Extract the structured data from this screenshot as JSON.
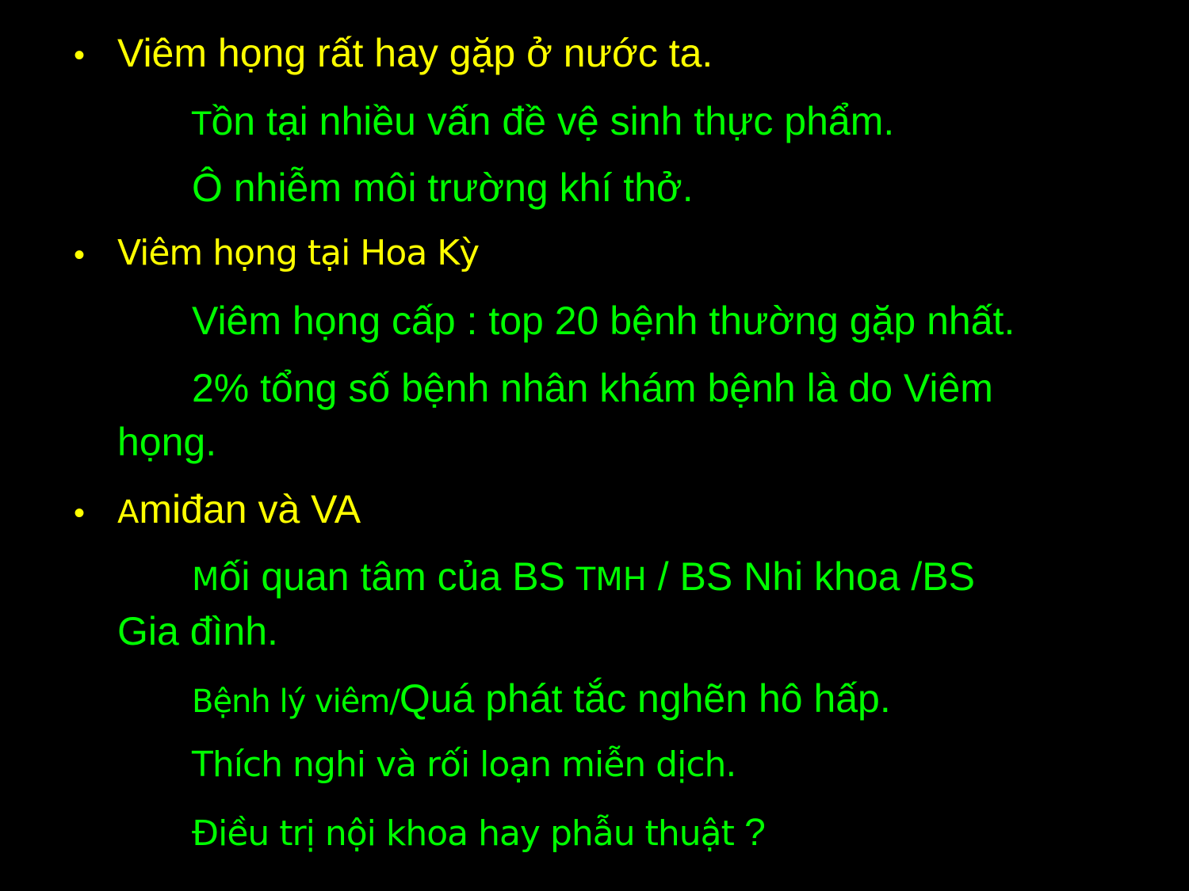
{
  "colors": {
    "background": "#000000",
    "heading": "#ffff00",
    "body": "#00ff00"
  },
  "bullet_glyph": "•",
  "sections": [
    {
      "heading": "Viêm họng rất hay gặp ở nước ta.",
      "items": [
        {
          "prefix": "T",
          "text": "ồn tại nhiều vấn đề vệ sinh thực phẩm."
        },
        {
          "text": "Ô nhiễm môi trường khí thở."
        }
      ]
    },
    {
      "heading": "Viêm họng tại Hoa Kỳ",
      "items": [
        {
          "text": "Viêm họng cấp : top 20 bệnh thường gặp nhất."
        },
        {
          "text": "2% tổng số bệnh nhân khám bệnh là do Viêm",
          "continuation": "họng."
        }
      ]
    },
    {
      "heading_prefix": "A",
      "heading": "miđan và VA",
      "items": [
        {
          "prefix": "M",
          "text_a": "ối quan tâm của BS ",
          "text_small": "TMH",
          "text_b": " / BS Nhi khoa /BS",
          "continuation": "Gia đình."
        },
        {
          "text_small": "Bệnh lý viêm/",
          "text": "Quá phát tắc nghẽn hô hấp."
        },
        {
          "text": "Thích nghi và rối loạn miễn dịch."
        },
        {
          "text": "Điều trị nội khoa hay phẫu thuật",
          "suffix": " ?"
        }
      ]
    }
  ]
}
